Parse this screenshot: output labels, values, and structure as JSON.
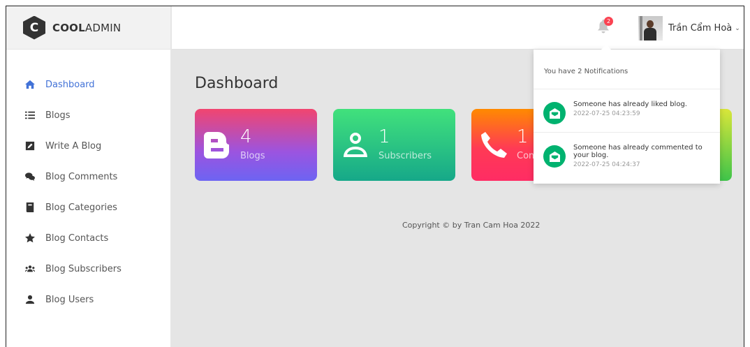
{
  "brand": {
    "logo_letter": "C",
    "bold": "COOL",
    "light": "ADMIN"
  },
  "sidebar": {
    "items": [
      {
        "label": "Dashboard",
        "icon": "home-icon",
        "active": true
      },
      {
        "label": "Blogs",
        "icon": "list-icon",
        "active": false
      },
      {
        "label": "Write A Blog",
        "icon": "edit-icon",
        "active": false
      },
      {
        "label": "Blog Comments",
        "icon": "comments-icon",
        "active": false
      },
      {
        "label": "Blog Categories",
        "icon": "book-icon",
        "active": false
      },
      {
        "label": "Blog Contacts",
        "icon": "star-icon",
        "active": false
      },
      {
        "label": "Blog Subscribers",
        "icon": "users-icon",
        "active": false
      },
      {
        "label": "Blog Users",
        "icon": "user-icon",
        "active": false
      }
    ]
  },
  "header": {
    "notification_count": "2",
    "user_name": "Trần Cẩm Hoà",
    "chevron": "⌄"
  },
  "main": {
    "title": "Dashboard",
    "cards": [
      {
        "value": "4",
        "label": "Blogs",
        "icon": "blogger-icon"
      },
      {
        "value": "1",
        "label": "Subscribers",
        "icon": "user-outline-icon"
      },
      {
        "value": "1",
        "label": "Contacts",
        "icon": "phone-icon"
      },
      {
        "value": "",
        "label": "",
        "icon": ""
      }
    ],
    "copyright": "Copyright © by Tran Cam Hoa 2022"
  },
  "notifications": {
    "title": "You have 2 Notifications",
    "items": [
      {
        "message": "Someone has already liked blog.",
        "time": "2022-07-25 04:23:59",
        "icon": "envelope-open-icon"
      },
      {
        "message": "Someone has already commented to your blog.",
        "time": "2022-07-25 04:24:37",
        "icon": "envelope-open-icon"
      }
    ]
  },
  "colors": {
    "accent": "#4272d7",
    "badge_red": "#fa4251",
    "notif_green": "#00b26f"
  }
}
